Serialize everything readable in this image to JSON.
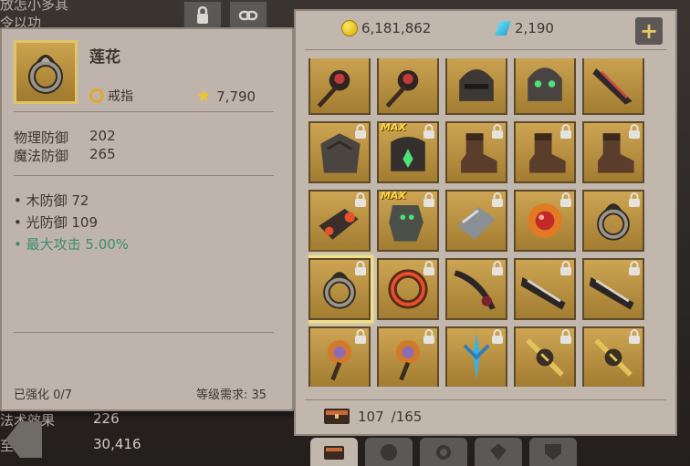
{
  "background": {
    "top_text_1": "放怎小多其",
    "top_text_2": "令以功",
    "stat_label_1": "法术效果",
    "stat_value_1": "226",
    "stat_label_2": "至",
    "stat_value_2": "30,416"
  },
  "item": {
    "name": "莲花",
    "type": "戒指",
    "price": "7,790",
    "stats": [
      {
        "label": "物理防御",
        "value": "202"
      },
      {
        "label": "魔法防御",
        "value": "265"
      }
    ],
    "bonuses": [
      {
        "text": "• 木防御 72",
        "color": "default"
      },
      {
        "text": "• 光防御 109",
        "color": "default"
      },
      {
        "text": "• 最大攻击 5.00%",
        "color": "#3f8c6e"
      }
    ],
    "enhance": "已强化 0/7",
    "level_req": "等级需求: 35"
  },
  "inventory": {
    "gold": "6,181,862",
    "gems": "2,190",
    "add_label": "+",
    "capacity_current": "107",
    "capacity_max": "/165",
    "max_badge": "MAX",
    "slots": [
      {
        "icon": "spider-staff-icon",
        "locked": false,
        "max": false
      },
      {
        "icon": "spider-staff-icon",
        "locked": false,
        "max": false
      },
      {
        "icon": "iron-helmet-icon",
        "locked": false,
        "max": false
      },
      {
        "icon": "skull-helmet-icon",
        "locked": false,
        "max": false
      },
      {
        "icon": "blade-icon",
        "locked": false,
        "max": false
      },
      {
        "icon": "rock-chest-icon",
        "locked": true,
        "max": false
      },
      {
        "icon": "dark-armor-icon",
        "locked": true,
        "max": true
      },
      {
        "icon": "leather-boot-icon",
        "locked": true,
        "max": false
      },
      {
        "icon": "leather-boot-icon",
        "locked": true,
        "max": false
      },
      {
        "icon": "leather-boot-icon",
        "locked": true,
        "max": false
      },
      {
        "icon": "ember-gauntlet-icon",
        "locked": true,
        "max": false
      },
      {
        "icon": "stone-gauntlet-icon",
        "locked": true,
        "max": true
      },
      {
        "icon": "chain-gauntlet-icon",
        "locked": true,
        "max": false
      },
      {
        "icon": "ruby-amulet-icon",
        "locked": true,
        "max": false
      },
      {
        "icon": "lotus-ring-icon",
        "locked": true,
        "max": false
      },
      {
        "icon": "lotus-ring-icon",
        "locked": true,
        "max": false,
        "selected": true
      },
      {
        "icon": "fire-ring-icon",
        "locked": true,
        "max": false
      },
      {
        "icon": "curved-sword-icon",
        "locked": true,
        "max": false
      },
      {
        "icon": "claw-blade-icon",
        "locked": true,
        "max": false
      },
      {
        "icon": "claw-blade-icon",
        "locked": true,
        "max": false
      },
      {
        "icon": "eye-staff-icon",
        "locked": true,
        "max": false
      },
      {
        "icon": "eye-staff-icon",
        "locked": true,
        "max": false
      },
      {
        "icon": "ice-trident-icon",
        "locked": true,
        "max": false
      },
      {
        "icon": "golden-trident-icon",
        "locked": true,
        "max": false
      },
      {
        "icon": "golden-trident-icon",
        "locked": true,
        "max": false
      }
    ]
  },
  "tabs": {
    "top": [
      "lock-icon",
      "chain-link-icon"
    ],
    "bottom": [
      "chest-icon",
      "rose-icon",
      "ring-icon",
      "leaf-icon",
      "shield-icon"
    ]
  }
}
